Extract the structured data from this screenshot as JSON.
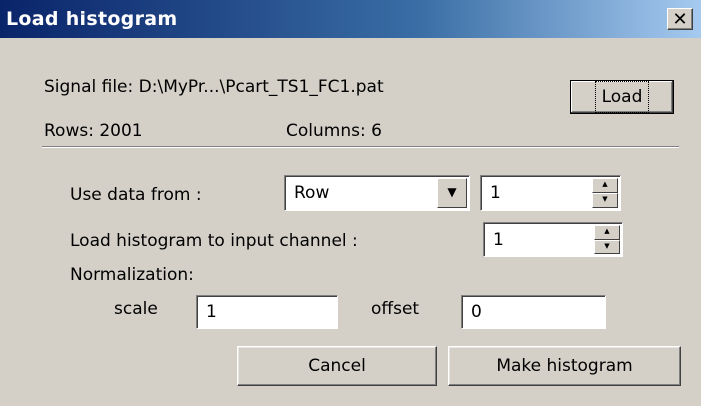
{
  "window": {
    "title": "Load histogram",
    "close_glyph": "✕"
  },
  "file": {
    "signal_file_text": "Signal file: D:\\MyPr...\\Pcart_TS1_FC1.pat",
    "load_label": "Load",
    "rows_text": "Rows: 2001",
    "columns_text": "Columns: 6"
  },
  "use_data": {
    "label": "Use data from :",
    "source_value": "Row",
    "index_value": "1"
  },
  "channel": {
    "label": "Load histogram to input channel :",
    "value": "1"
  },
  "normalization": {
    "label": "Normalization:",
    "scale_label": "scale",
    "scale_value": "1",
    "offset_label": "offset",
    "offset_value": "0"
  },
  "buttons": {
    "cancel": "Cancel",
    "make": "Make histogram"
  },
  "icons": {
    "close": "close-icon",
    "dropdown": "chevron-down-icon",
    "spin_up": "spin-up-icon",
    "spin_down": "spin-down-icon"
  }
}
